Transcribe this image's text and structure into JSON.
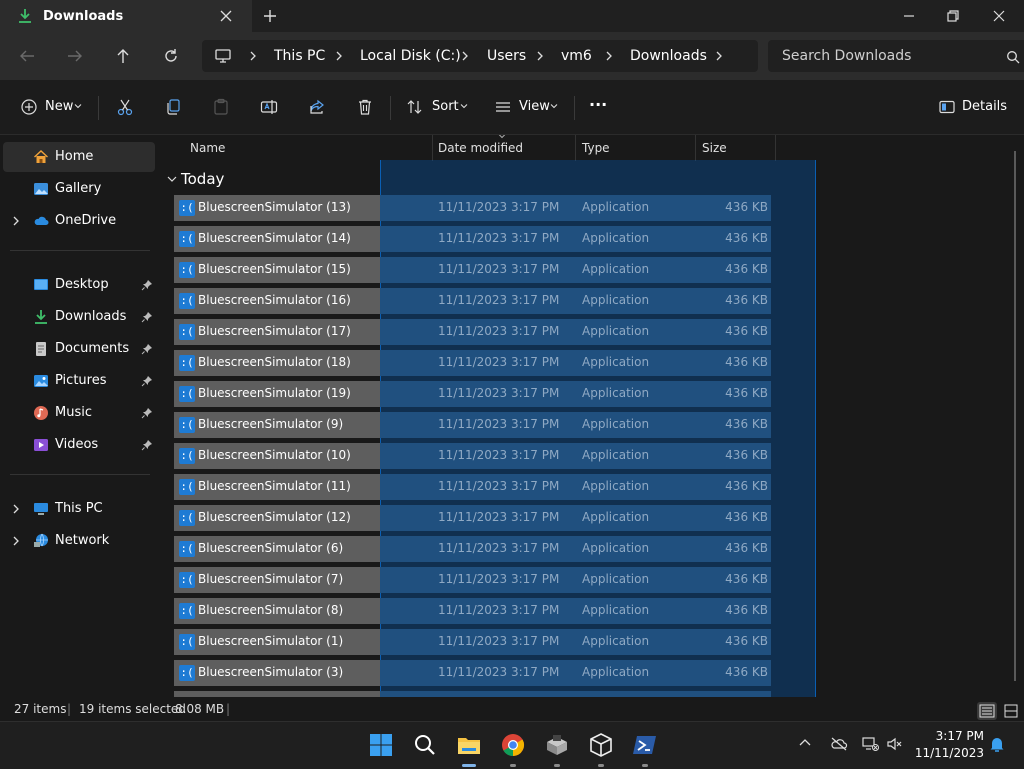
{
  "window": {
    "tab_title": "Downloads",
    "new_tab_symbol": "+"
  },
  "breadcrumb": [
    "This PC",
    "Local Disk (C:)",
    "Users",
    "vm6",
    "Downloads"
  ],
  "search": {
    "placeholder": "Search Downloads"
  },
  "toolbar": {
    "new_label": "New",
    "sort_label": "Sort",
    "view_label": "View",
    "more_label": "···",
    "details_label": "Details"
  },
  "sidebar": {
    "items": [
      {
        "label": "Home",
        "icon": "home-icon"
      },
      {
        "label": "Gallery",
        "icon": "gallery-icon"
      },
      {
        "label": "OneDrive",
        "icon": "onedrive-icon"
      },
      {
        "label": "Desktop",
        "icon": "desktop-icon"
      },
      {
        "label": "Downloads",
        "icon": "downloads-icon"
      },
      {
        "label": "Documents",
        "icon": "documents-icon"
      },
      {
        "label": "Pictures",
        "icon": "pictures-icon"
      },
      {
        "label": "Music",
        "icon": "music-icon"
      },
      {
        "label": "Videos",
        "icon": "videos-icon"
      },
      {
        "label": "This PC",
        "icon": "this-pc-icon"
      },
      {
        "label": "Network",
        "icon": "network-icon"
      }
    ]
  },
  "columns": {
    "name": "Name",
    "date": "Date modified",
    "type": "Type",
    "size": "Size"
  },
  "group_label": "Today",
  "files": [
    {
      "name": "BluescreenSimulator (13)",
      "date": "11/11/2023 3:17 PM",
      "type": "Application",
      "size": "436 KB"
    },
    {
      "name": "BluescreenSimulator (14)",
      "date": "11/11/2023 3:17 PM",
      "type": "Application",
      "size": "436 KB"
    },
    {
      "name": "BluescreenSimulator (15)",
      "date": "11/11/2023 3:17 PM",
      "type": "Application",
      "size": "436 KB"
    },
    {
      "name": "BluescreenSimulator (16)",
      "date": "11/11/2023 3:17 PM",
      "type": "Application",
      "size": "436 KB"
    },
    {
      "name": "BluescreenSimulator (17)",
      "date": "11/11/2023 3:17 PM",
      "type": "Application",
      "size": "436 KB"
    },
    {
      "name": "BluescreenSimulator (18)",
      "date": "11/11/2023 3:17 PM",
      "type": "Application",
      "size": "436 KB"
    },
    {
      "name": "BluescreenSimulator (19)",
      "date": "11/11/2023 3:17 PM",
      "type": "Application",
      "size": "436 KB"
    },
    {
      "name": "BluescreenSimulator (9)",
      "date": "11/11/2023 3:17 PM",
      "type": "Application",
      "size": "436 KB"
    },
    {
      "name": "BluescreenSimulator (10)",
      "date": "11/11/2023 3:17 PM",
      "type": "Application",
      "size": "436 KB"
    },
    {
      "name": "BluescreenSimulator (11)",
      "date": "11/11/2023 3:17 PM",
      "type": "Application",
      "size": "436 KB"
    },
    {
      "name": "BluescreenSimulator (12)",
      "date": "11/11/2023 3:17 PM",
      "type": "Application",
      "size": "436 KB"
    },
    {
      "name": "BluescreenSimulator (6)",
      "date": "11/11/2023 3:17 PM",
      "type": "Application",
      "size": "436 KB"
    },
    {
      "name": "BluescreenSimulator (7)",
      "date": "11/11/2023 3:17 PM",
      "type": "Application",
      "size": "436 KB"
    },
    {
      "name": "BluescreenSimulator (8)",
      "date": "11/11/2023 3:17 PM",
      "type": "Application",
      "size": "436 KB"
    },
    {
      "name": "BluescreenSimulator (1)",
      "date": "11/11/2023 3:17 PM",
      "type": "Application",
      "size": "436 KB"
    },
    {
      "name": "BluescreenSimulator (3)",
      "date": "11/11/2023 3:17 PM",
      "type": "Application",
      "size": "436 KB"
    }
  ],
  "file_icon_glyph": ":(",
  "status": {
    "item_count": "27 items",
    "selected": "19 items selected",
    "selected_size": "8.08 MB"
  },
  "clock": {
    "time": "3:17 PM",
    "date": "11/11/2023"
  },
  "colors": {
    "accent": "#0a5fb4",
    "selection_overlay": "#20507f",
    "row_fill": "#5e5e5e"
  }
}
